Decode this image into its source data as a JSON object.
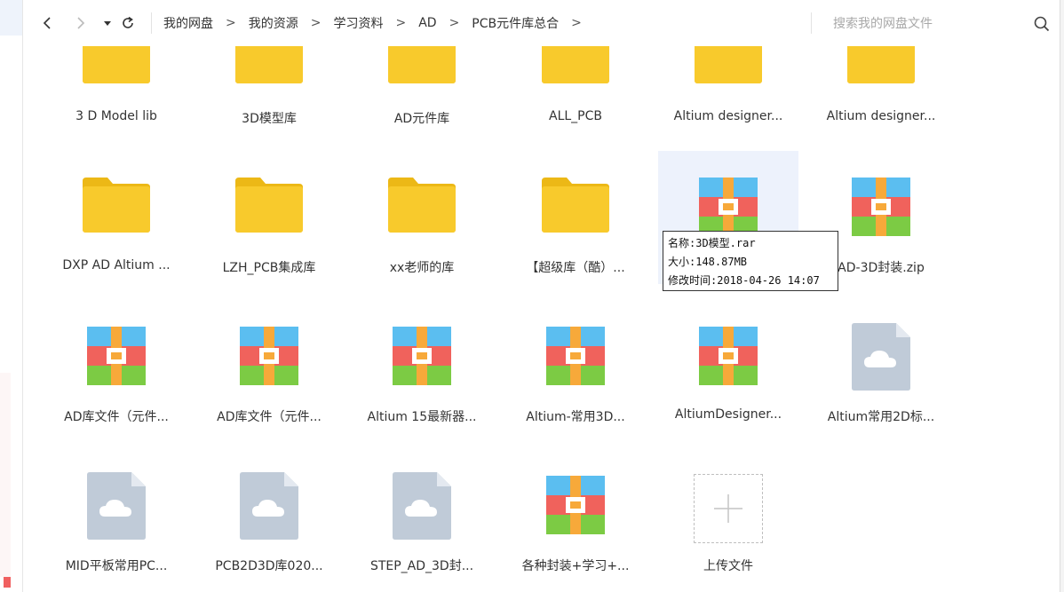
{
  "toolbar": {
    "breadcrumb": [
      "我的网盘",
      "我的资源",
      "学习资料",
      "AD",
      "PCB元件库总合"
    ],
    "separator": ">",
    "search_placeholder": "搜索我的网盘文件"
  },
  "files": [
    {
      "name": "3 D Model lib",
      "type": "folder"
    },
    {
      "name": "3D模型库",
      "type": "folder"
    },
    {
      "name": "AD元件库",
      "type": "folder"
    },
    {
      "name": "ALL_PCB",
      "type": "folder"
    },
    {
      "name": "Altium designer...",
      "type": "folder"
    },
    {
      "name": "Altium designer...",
      "type": "folder"
    },
    {
      "name": "DXP AD Altium ...",
      "type": "folder"
    },
    {
      "name": "LZH_PCB集成库",
      "type": "folder"
    },
    {
      "name": "xx老师的库",
      "type": "folder"
    },
    {
      "name": "【超级库（酷）...",
      "type": "folder"
    },
    {
      "name": "",
      "type": "archive"
    },
    {
      "name": "AD-3D封装.zip",
      "type": "archive"
    },
    {
      "name": "AD库文件（元件...",
      "type": "archive"
    },
    {
      "name": "AD库文件（元件...",
      "type": "archive"
    },
    {
      "name": "Altium 15最新器...",
      "type": "archive"
    },
    {
      "name": "Altium-常用3D...",
      "type": "archive"
    },
    {
      "name": "AltiumDesigner...",
      "type": "archive"
    },
    {
      "name": "Altium常用2D标...",
      "type": "cloud"
    },
    {
      "name": "MID平板常用PC...",
      "type": "cloud"
    },
    {
      "name": "PCB2D3D库020...",
      "type": "cloud"
    },
    {
      "name": "STEP_AD_3D封...",
      "type": "cloud"
    },
    {
      "name": "各种封装+学习+...",
      "type": "archive"
    }
  ],
  "upload": {
    "label": "上传文件"
  },
  "tooltip": {
    "name": "名称:3D模型.rar",
    "size": "大小:148.87MB",
    "modified": "修改时间:2018-04-26 14:07"
  },
  "colors": {
    "folder": "#f8ca2c",
    "folder_tab": "#ecb816",
    "archive_blue": "#5bbef0",
    "archive_red": "#f0625c",
    "archive_green": "#7ccb44",
    "archive_band": "#f7a93a",
    "cloud_doc": "#c0cbd8",
    "hover_bg": "#edf2fc"
  }
}
